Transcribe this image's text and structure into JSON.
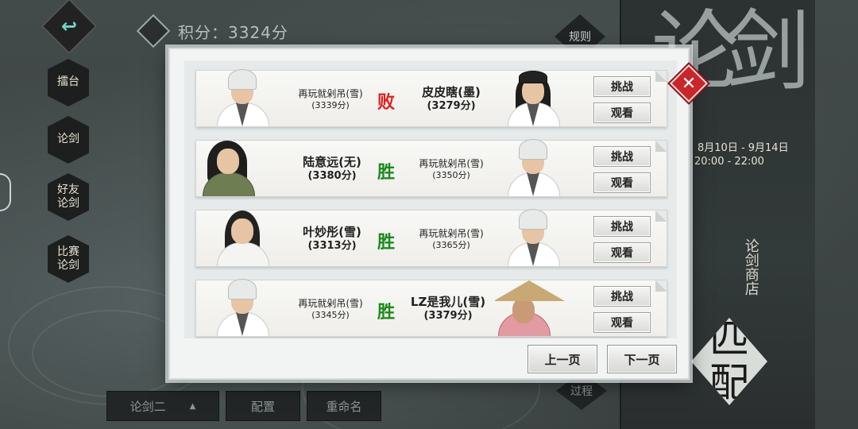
{
  "score": {
    "label": "积分：3324分"
  },
  "header": {
    "rules_label": "规则"
  },
  "nav": {
    "back_icon": "↩",
    "items": [
      {
        "label": "擂台"
      },
      {
        "label": "论剑"
      },
      {
        "label": "好友\n论剑"
      },
      {
        "label": "比赛\n论剑"
      }
    ]
  },
  "poster": {
    "title": "论剑",
    "date": "8月10日 - 9月14日",
    "time": "20:00 - 22:00",
    "shop_label": "论剑商店",
    "match_label": "匹配",
    "process_label": "过程"
  },
  "bottom": {
    "mode_label": "论剑二",
    "config_label": "配置",
    "rename_label": "重命名"
  },
  "dialog": {
    "close_icon": "✕",
    "prev_label": "上一页",
    "next_label": "下一页",
    "matches": [
      {
        "left": {
          "name": "再玩就剁吊(雪)",
          "score": "(3339分)"
        },
        "result": "败",
        "result_color": "#e01e1e",
        "right": {
          "name": "皮皮瞎(墨)",
          "score": "(3279分)"
        },
        "challenge_label": "挑战",
        "watch_label": "观看"
      },
      {
        "left": {
          "name": "陆意远(无)",
          "score": "(3380分)"
        },
        "result": "胜",
        "result_color": "#1a8a1a",
        "right": {
          "name": "再玩就剁吊(雪)",
          "score": "(3350分)"
        },
        "challenge_label": "挑战",
        "watch_label": "观看"
      },
      {
        "left": {
          "name": "叶妙彤(雪)",
          "score": "(3313分)"
        },
        "result": "胜",
        "result_color": "#1a8a1a",
        "right": {
          "name": "再玩就剁吊(雪)",
          "score": "(3365分)"
        },
        "challenge_label": "挑战",
        "watch_label": "观看"
      },
      {
        "left": {
          "name": "再玩就剁吊(雪)",
          "score": "(3345分)"
        },
        "result": "胜",
        "result_color": "#1a8a1a",
        "right": {
          "name": "LZ是我儿(雪)",
          "score": "(3379分)"
        },
        "challenge_label": "挑战",
        "watch_label": "观看"
      }
    ]
  }
}
